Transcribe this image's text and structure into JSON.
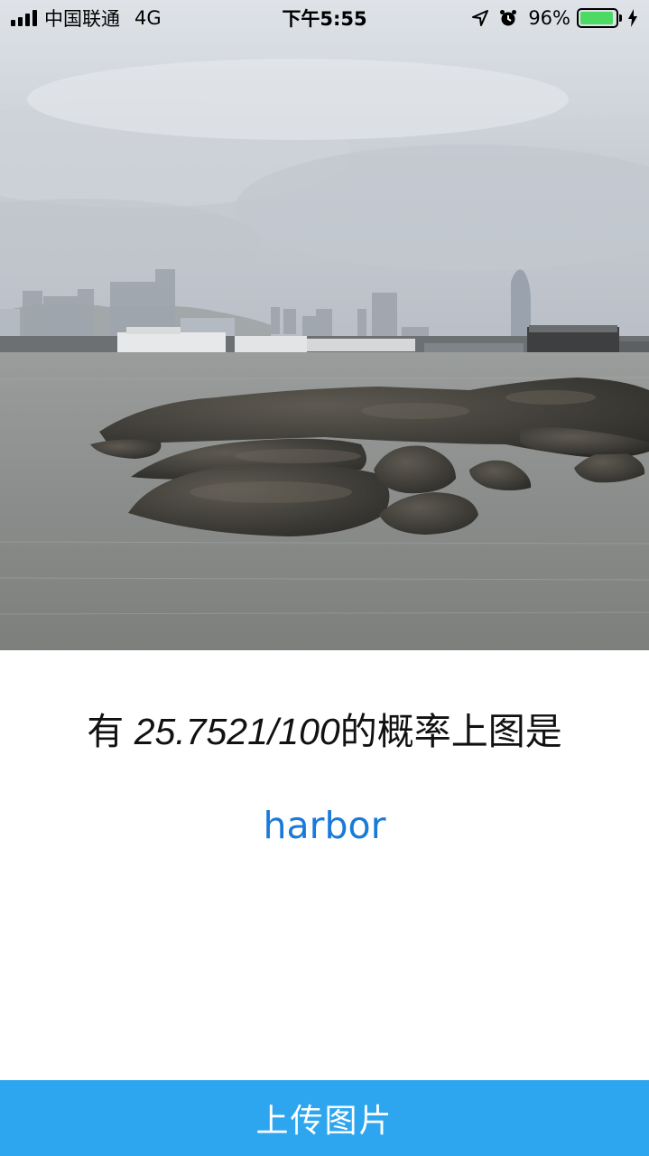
{
  "status_bar": {
    "carrier": "中国联通",
    "network": "4G",
    "time": "下午5:55",
    "battery_percent": "96%",
    "battery_level": 0.96,
    "icons": [
      "signal-icon",
      "location-arrow-icon",
      "alarm-icon",
      "battery-icon",
      "charging-bolt-icon"
    ]
  },
  "photo": {
    "subject": "harbor-photo"
  },
  "result": {
    "prefix": "有 ",
    "probability": "25.7521/100",
    "suffix": "的概率上图是",
    "label": "harbor"
  },
  "upload": {
    "label": "上传图片"
  },
  "colors": {
    "accent_blue": "#2ea6ef",
    "label_blue": "#1a7ad8",
    "battery_green": "#4cd964"
  }
}
